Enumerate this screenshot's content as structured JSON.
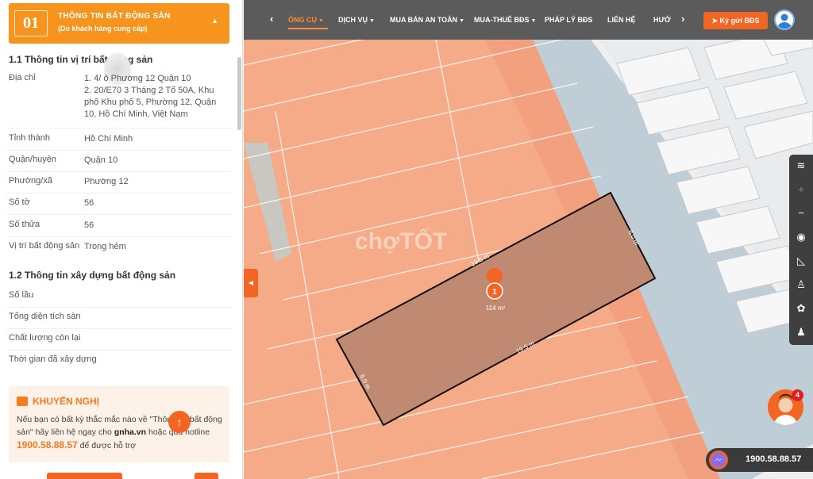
{
  "header": {
    "number": "01",
    "title": "THÔNG TIN BẤT ĐỘNG SẢN",
    "subtitle": "(Do khách hàng cung cấp)"
  },
  "location": {
    "title": "1.1 Thông tin vị trí bất động sản",
    "rows": [
      {
        "key": "Địa chỉ",
        "value_1": "1. 4/  ô Phường 12 Quận 10",
        "value_2": "2. 20/E70 3 Tháng 2 Tổ 50A, Khu phố Khu phố 5, Phường 12, Quận 10, Hồ Chí Minh, Việt Nam"
      },
      {
        "key": "Tỉnh thành",
        "value": "Hồ Chí Minh"
      },
      {
        "key": "Quận/huyện",
        "value": "Quận 10"
      },
      {
        "key": "Phường/xã",
        "value": "Phường 12"
      },
      {
        "key": "Số tờ",
        "value": "56"
      },
      {
        "key": "Số thửa",
        "value": "56"
      },
      {
        "key": "Vị trí bất động sản",
        "value": "Trong hẻm"
      }
    ]
  },
  "building": {
    "title": "1.2 Thông tin xây dựng bất động sản",
    "rows": [
      {
        "key": "Số lầu"
      },
      {
        "key": "Tổng diện tích sàn"
      },
      {
        "key": "Chất lượng còn lại"
      },
      {
        "key": "Thời gian đã xây dựng"
      }
    ]
  },
  "advice": {
    "title": "KHUYẾN NGHỊ",
    "text_1": "Nếu bạn có bất kỳ thắc mắc nào về \"Thông tin bất động sản\" hãy liên hệ ngay cho ",
    "site": "gnha.vn",
    "text_2": " hoặc qua hotline ",
    "phone": "1900.58.88.57",
    "text_3": " để được hỗ trợ"
  },
  "nav": {
    "items": [
      {
        "label": "ÔNG CỤ",
        "active": true
      },
      {
        "label": "DỊCH VỤ"
      },
      {
        "label": "MUA BÁN AN TOÀN"
      },
      {
        "label": "MUA-THUÊ BĐS"
      },
      {
        "label": "PHÁP LÝ BĐS"
      },
      {
        "label": "LIÊN HỆ"
      },
      {
        "label": "HƯỚ"
      }
    ],
    "post_button": "Ký gửi BĐS"
  },
  "map": {
    "watermark": "chợTỐT",
    "parcel": {
      "marker": "1",
      "area": "114 m²",
      "edge_top": "19.5 m",
      "edge_bottom": "19.5 m",
      "edge_left": "6.0 m",
      "edge_right": "6.0 m"
    },
    "colors": {
      "parcel_fill": "#c08a72",
      "lot_fill": "#f5ab87",
      "road": "#bfcdd6"
    }
  },
  "toolbar": {
    "icons": [
      "layers-icon",
      "zoom-in-icon",
      "zoom-out-icon",
      "location-icon",
      "ruler-icon",
      "person-icon",
      "palette-icon",
      "streetview-icon"
    ]
  },
  "support": {
    "badge": "4",
    "hotline": "1900.58.88.57"
  }
}
